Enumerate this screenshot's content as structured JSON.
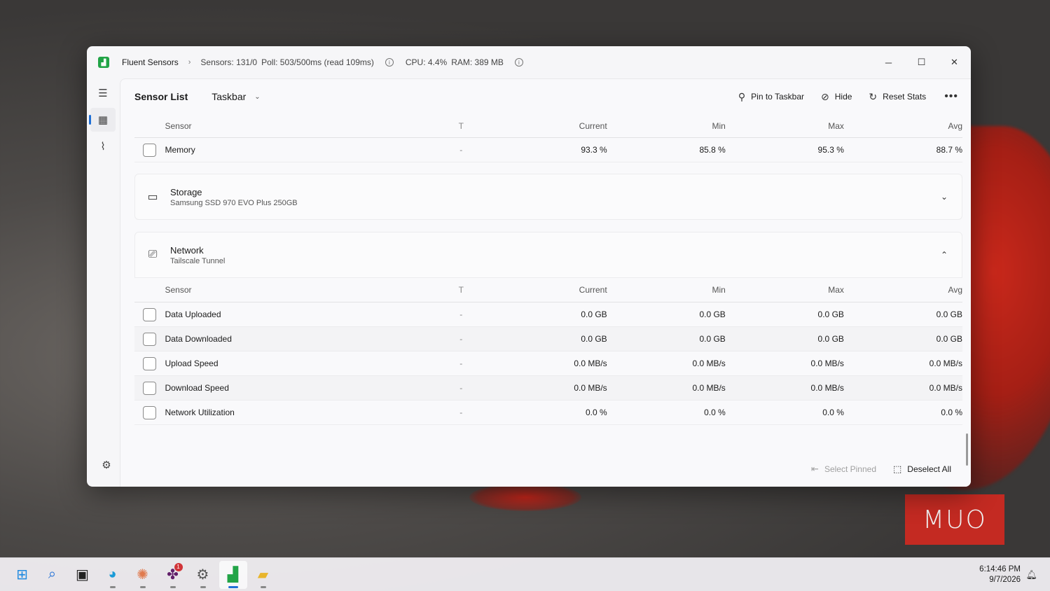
{
  "window": {
    "app_title": "Fluent Sensors",
    "stats": {
      "sensors": "Sensors: 131/0",
      "poll": "Poll: 503/500ms (read 109ms)",
      "cpu": "CPU: 4.4%",
      "ram": "RAM: 389 MB"
    }
  },
  "toolbar": {
    "title": "Sensor List",
    "dropdown_value": "Taskbar",
    "pin_label": "Pin to Taskbar",
    "hide_label": "Hide",
    "reset_label": "Reset Stats"
  },
  "columns": {
    "sensor": "Sensor",
    "t": "T",
    "current": "Current",
    "min": "Min",
    "max": "Max",
    "avg": "Avg"
  },
  "memory_rows": [
    {
      "name": "Memory",
      "t": "-",
      "current": "93.3 %",
      "min": "85.8 %",
      "max": "95.3 %",
      "avg": "88.7 %"
    }
  ],
  "storage_card": {
    "title": "Storage",
    "subtitle": "Samsung SSD 970 EVO Plus 250GB"
  },
  "network_card": {
    "title": "Network",
    "subtitle": "Tailscale Tunnel"
  },
  "network_rows": [
    {
      "name": "Data Uploaded",
      "t": "-",
      "current": "0.0 GB",
      "min": "0.0 GB",
      "max": "0.0 GB",
      "avg": "0.0 GB"
    },
    {
      "name": "Data Downloaded",
      "t": "-",
      "current": "0.0 GB",
      "min": "0.0 GB",
      "max": "0.0 GB",
      "avg": "0.0 GB"
    },
    {
      "name": "Upload Speed",
      "t": "-",
      "current": "0.0 MB/s",
      "min": "0.0 MB/s",
      "max": "0.0 MB/s",
      "avg": "0.0 MB/s"
    },
    {
      "name": "Download Speed",
      "t": "-",
      "current": "0.0 MB/s",
      "min": "0.0 MB/s",
      "max": "0.0 MB/s",
      "avg": "0.0 MB/s"
    },
    {
      "name": "Network Utilization",
      "t": "-",
      "current": "0.0 %",
      "min": "0.0 %",
      "max": "0.0 %",
      "avg": "0.0 %"
    }
  ],
  "footer": {
    "select_pinned": "Select Pinned",
    "deselect_all": "Deselect All"
  },
  "taskbar": {
    "time": "6:14:46 PM",
    "date": "9/7/2026",
    "badge_count": "1"
  },
  "watermark": "MUO",
  "colors": {
    "accent": "#1f6fd6",
    "app_icon": "#22a447",
    "watermark_bg": "#c42a22"
  }
}
